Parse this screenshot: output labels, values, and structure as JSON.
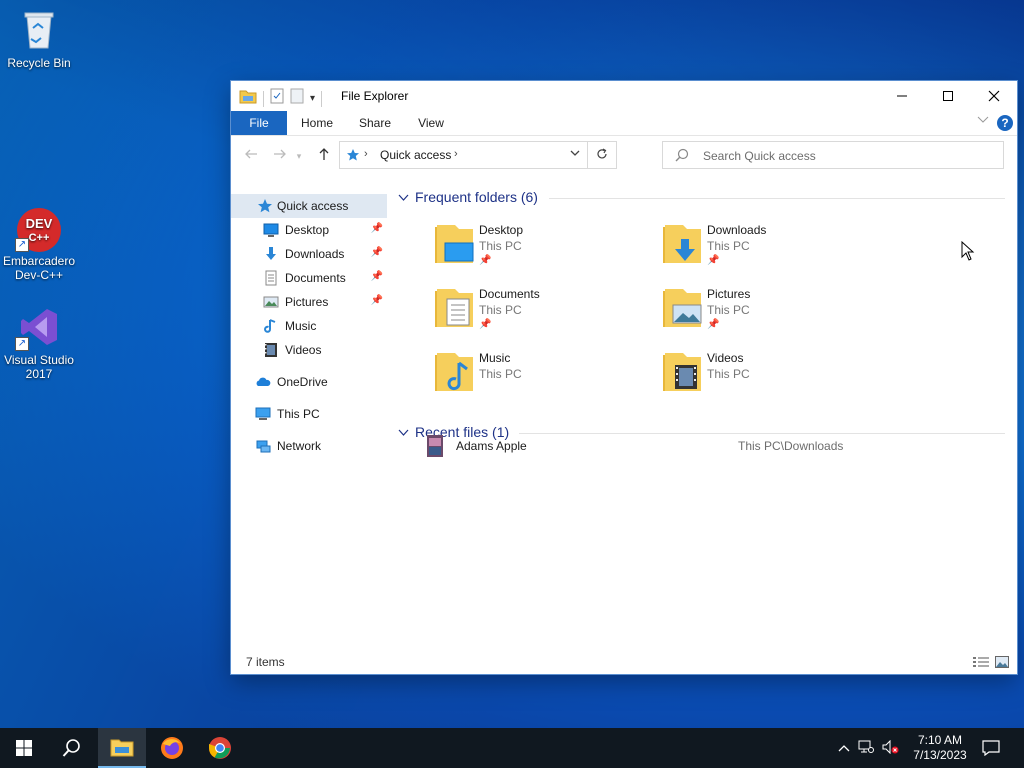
{
  "desktop": {
    "icons": [
      {
        "label": "Recycle Bin",
        "icon": "recycle-bin-icon"
      },
      {
        "label_line1": "Embarcadero",
        "label_line2": "Dev-C++",
        "icon": "dev-cpp-icon",
        "logo_text_1": "DEV",
        "logo_text_2": "C++"
      },
      {
        "label_line1": "Visual Studio",
        "label_line2": "2017",
        "icon": "visual-studio-icon"
      }
    ]
  },
  "window": {
    "title": "File Explorer",
    "ribbon_tabs": [
      "File",
      "Home",
      "Share",
      "View"
    ],
    "help_label": "?",
    "address": {
      "crumb": "Quick access"
    },
    "search": {
      "placeholder": "Search Quick access"
    },
    "nav_pane": {
      "items": [
        {
          "label": "Quick access",
          "icon": "star-icon",
          "selected": true
        },
        {
          "label": "Desktop",
          "icon": "desktop-icon",
          "pinned": true
        },
        {
          "label": "Downloads",
          "icon": "download-icon",
          "pinned": true
        },
        {
          "label": "Documents",
          "icon": "document-icon",
          "pinned": true
        },
        {
          "label": "Pictures",
          "icon": "picture-icon",
          "pinned": true
        },
        {
          "label": "Music",
          "icon": "music-icon"
        },
        {
          "label": "Videos",
          "icon": "video-icon"
        },
        {
          "label": "OneDrive",
          "icon": "cloud-icon"
        },
        {
          "label": "This PC",
          "icon": "pc-icon"
        },
        {
          "label": "Network",
          "icon": "network-icon"
        }
      ]
    },
    "frequent": {
      "header": "Frequent folders (6)",
      "folders": [
        {
          "name": "Desktop",
          "location": "This PC",
          "pinned": true
        },
        {
          "name": "Downloads",
          "location": "This PC",
          "pinned": true
        },
        {
          "name": "Documents",
          "location": "This PC",
          "pinned": true
        },
        {
          "name": "Pictures",
          "location": "This PC",
          "pinned": true
        },
        {
          "name": "Music",
          "location": "This PC"
        },
        {
          "name": "Videos",
          "location": "This PC"
        }
      ]
    },
    "recent": {
      "header": "Recent files (1)",
      "files": [
        {
          "name": "Adams Apple",
          "path": "This PC\\Downloads"
        }
      ]
    },
    "status": {
      "item_count": "7 items"
    }
  },
  "taskbar": {
    "apps": [
      "start",
      "search",
      "file-explorer",
      "firefox",
      "chrome"
    ],
    "clock": {
      "time": "7:10 AM",
      "date": "7/13/2023"
    }
  },
  "colors": {
    "accent": "#1a66c0",
    "group_header": "#1e3287",
    "taskbar": "#101820"
  }
}
